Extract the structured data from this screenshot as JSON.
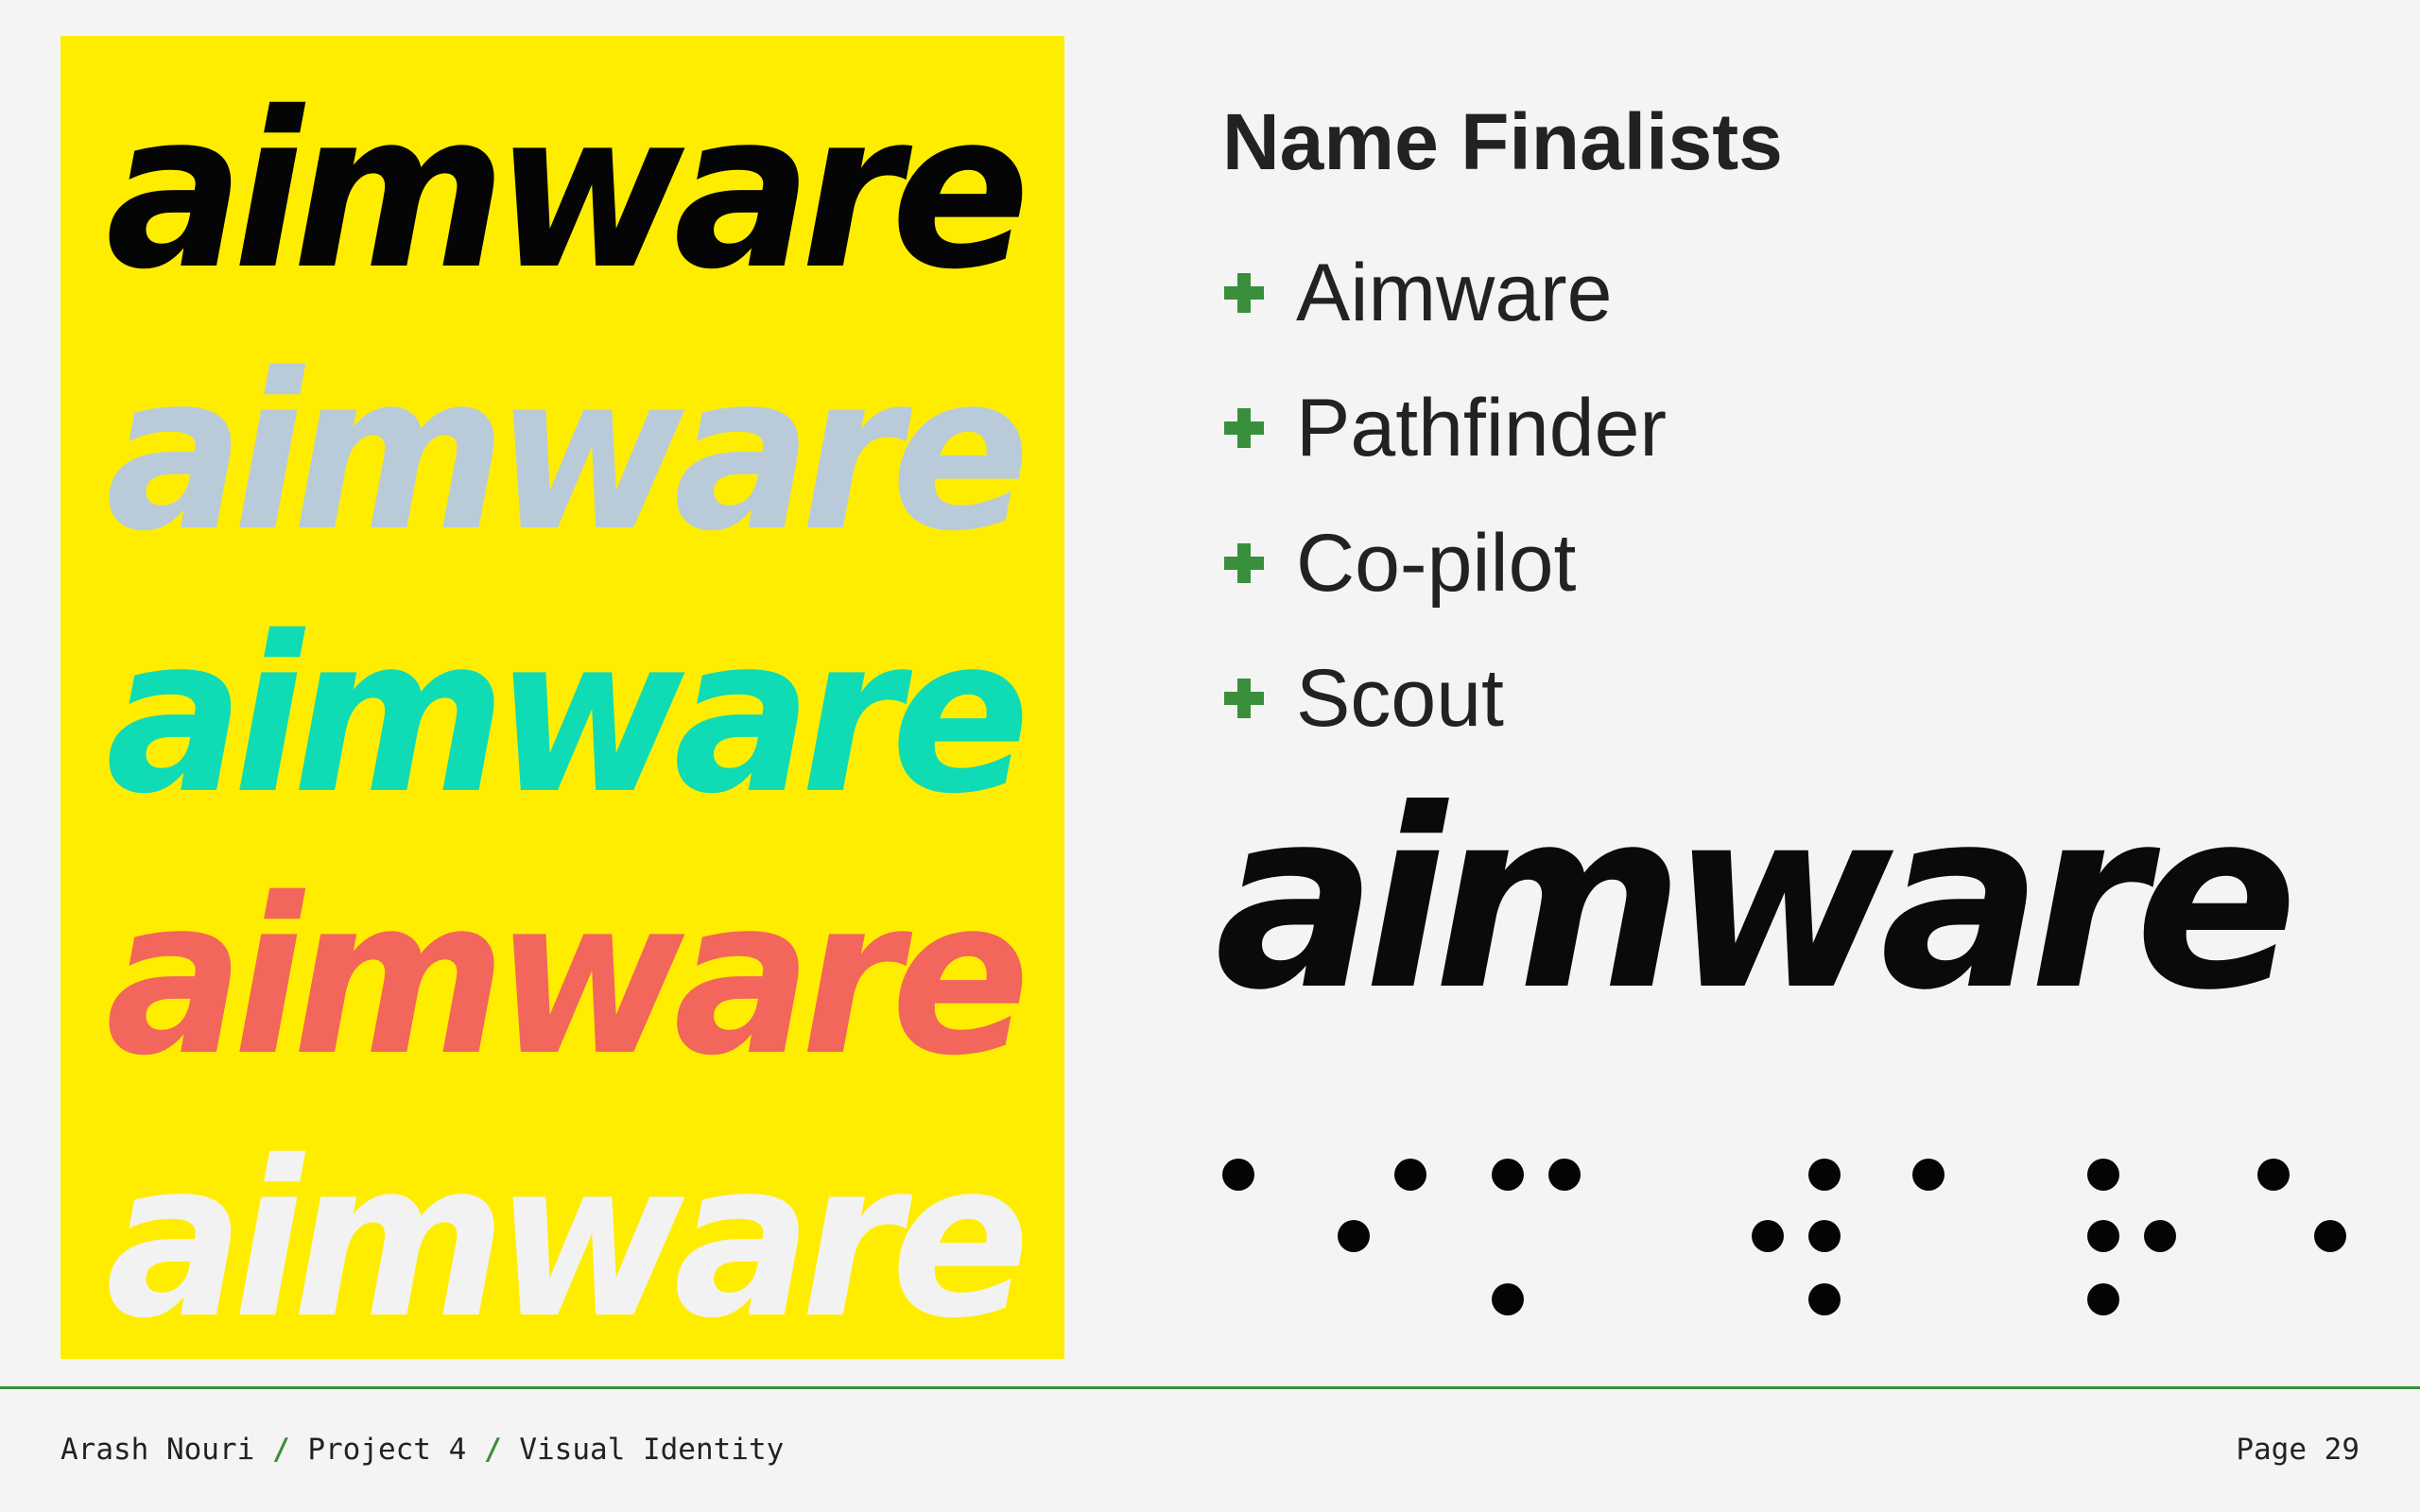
{
  "poster": {
    "background": "#ffed00",
    "words": [
      {
        "text": "aimware",
        "color": "#050505"
      },
      {
        "text": "aimware",
        "color": "#b9cbd9"
      },
      {
        "text": "aimware",
        "color": "#0fdcb4"
      },
      {
        "text": "aimware",
        "color": "#f2665c"
      },
      {
        "text": "aimware",
        "color": "#f2f2f2"
      }
    ]
  },
  "heading": "Name Finalists",
  "finalists": [
    {
      "label": "Aimware",
      "icon": "plus-icon"
    },
    {
      "label": "Pathfinder",
      "icon": "plus-icon"
    },
    {
      "label": "Co-pilot",
      "icon": "plus-icon"
    },
    {
      "label": "Scout",
      "icon": "plus-icon"
    }
  ],
  "logo": {
    "text": "aimware",
    "color": "#0a0a0a"
  },
  "braille": {
    "text": "aimware",
    "dot_color": "#050505"
  },
  "footer": {
    "author": "Arash Nouri",
    "separator": "/",
    "project": "Project 4",
    "section": "Visual Identity",
    "page": "Page 29"
  },
  "colors": {
    "accent": "#3a8f3d",
    "text": "#222222",
    "background": "#f4f4f4"
  }
}
